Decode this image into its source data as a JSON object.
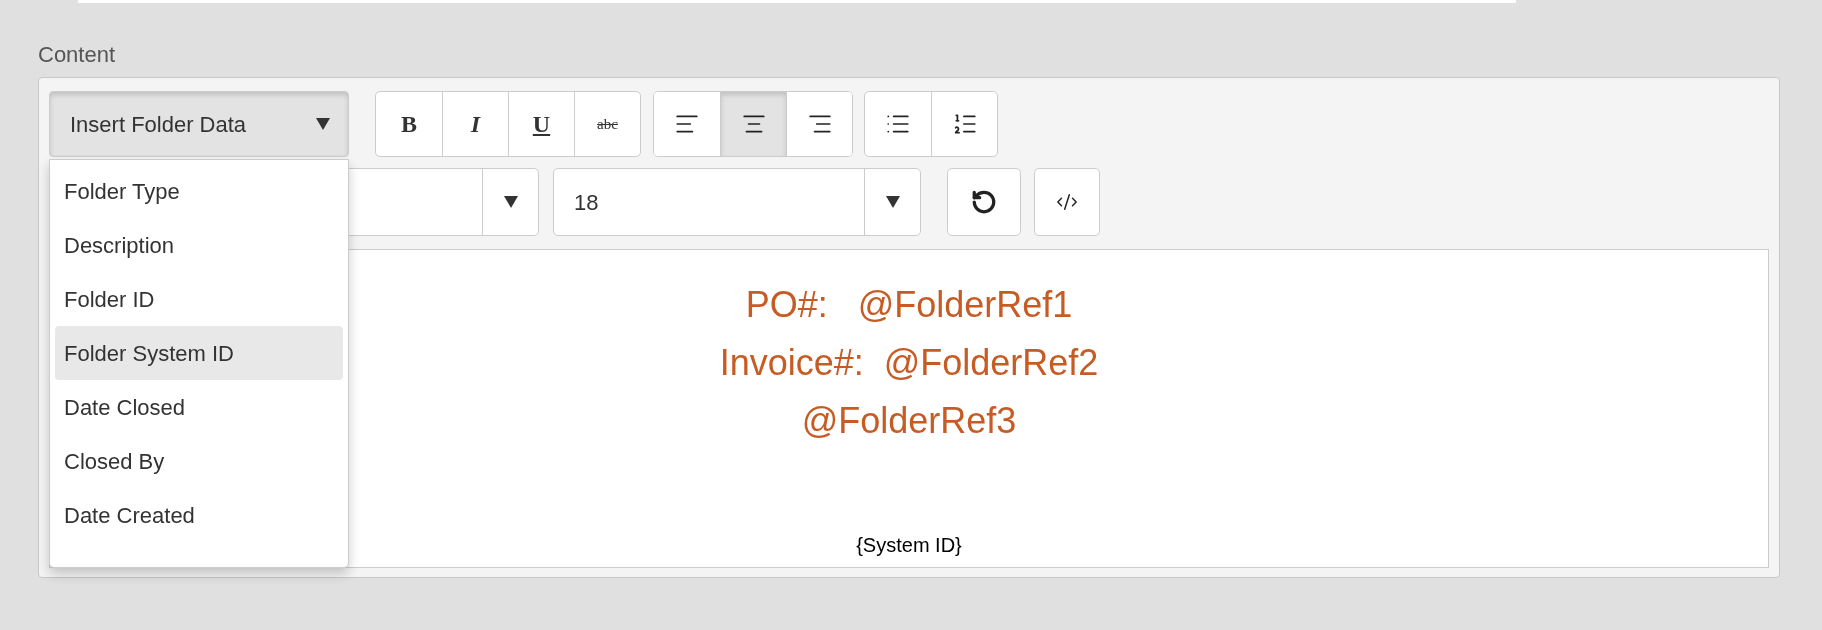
{
  "content_label": "Content",
  "editor": {
    "insert_menu": {
      "label": "Insert Folder Data",
      "expanded": true,
      "items": [
        {
          "label": "Folder Type",
          "selected": false
        },
        {
          "label": "Description",
          "selected": false
        },
        {
          "label": "Folder ID",
          "selected": false
        },
        {
          "label": "Folder System ID",
          "selected": true
        },
        {
          "label": "Date Closed",
          "selected": false
        },
        {
          "label": "Closed By",
          "selected": false
        },
        {
          "label": "Date Created",
          "selected": false
        }
      ]
    },
    "format_buttons": [
      {
        "kind": "bold",
        "label": "B"
      },
      {
        "kind": "italic",
        "label": "I"
      },
      {
        "kind": "underline",
        "label": "U"
      },
      {
        "kind": "strikethrough",
        "label": "abc"
      }
    ],
    "align_buttons": [
      {
        "kind": "left",
        "selected": false
      },
      {
        "kind": "center",
        "selected": true
      },
      {
        "kind": "right",
        "selected": false
      }
    ],
    "list_buttons": [
      {
        "kind": "bulleted"
      },
      {
        "kind": "numbered"
      }
    ],
    "font_size": {
      "value": "18"
    },
    "tool_buttons": [
      {
        "kind": "undo"
      },
      {
        "kind": "code"
      }
    ],
    "body": {
      "lines": [
        "PO#:   @FolderRef1",
        "Invoice#:  @FolderRef2",
        "@FolderRef3"
      ],
      "footer": "{System ID}"
    }
  }
}
